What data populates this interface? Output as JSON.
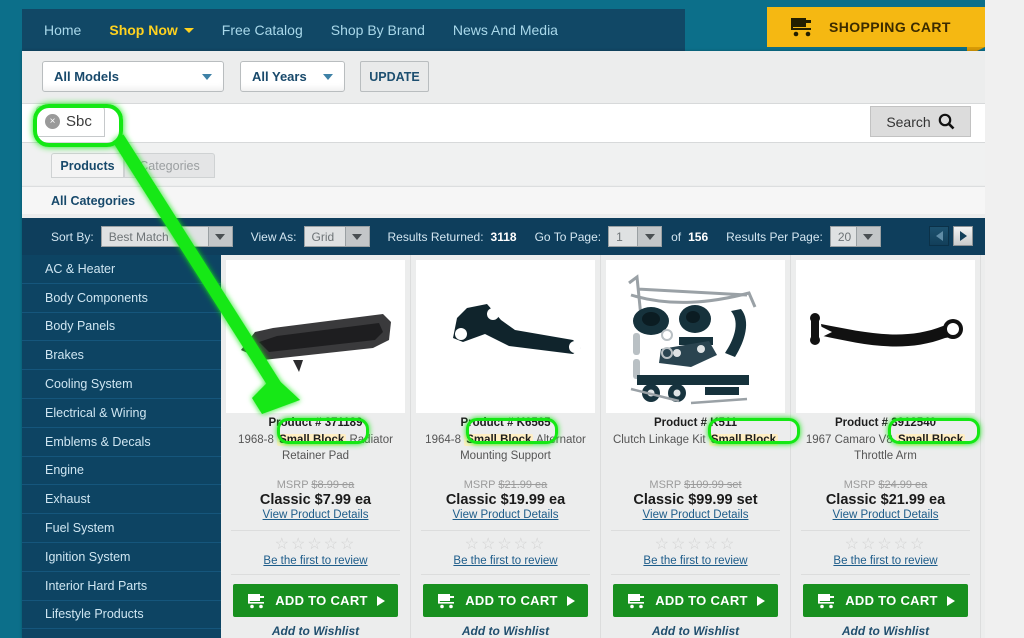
{
  "nav": {
    "items": [
      {
        "label": "Home",
        "active": false
      },
      {
        "label": "Shop Now",
        "active": true
      },
      {
        "label": "Free Catalog",
        "active": false
      },
      {
        "label": "Shop By Brand",
        "active": false
      },
      {
        "label": "News And Media",
        "active": false
      }
    ],
    "cart_label": "SHOPPING CART"
  },
  "filters": {
    "models": "All Models",
    "years": "All Years",
    "update_label": "UPDATE"
  },
  "search": {
    "chip_label": "Sbc",
    "chip_remove": "×",
    "button_label": "Search",
    "input_value": "",
    "placeholder": ""
  },
  "tabs": {
    "products": "Products",
    "categories": "Categories",
    "all_categories": "All Categories"
  },
  "toolbar": {
    "sort_by_label": "Sort By:",
    "sort_by_value": "Best Match",
    "view_as_label": "View As:",
    "view_as_value": "Grid",
    "results_returned_label": "Results Returned:",
    "results_returned_value": "3118",
    "go_to_page_label": "Go To Page:",
    "go_to_page_value": "1",
    "of_label": "of",
    "total_pages": "156",
    "results_per_page_label": "Results Per Page:",
    "results_per_page_value": "20"
  },
  "sidebar": {
    "items": [
      {
        "label": "AC & Heater"
      },
      {
        "label": "Body Components"
      },
      {
        "label": "Body Panels"
      },
      {
        "label": "Brakes"
      },
      {
        "label": "Cooling System"
      },
      {
        "label": "Electrical & Wiring"
      },
      {
        "label": "Emblems & Decals"
      },
      {
        "label": "Engine"
      },
      {
        "label": "Exhaust"
      },
      {
        "label": "Fuel System"
      },
      {
        "label": "Ignition System"
      },
      {
        "label": "Interior Hard Parts"
      },
      {
        "label": "Lifestyle Products"
      }
    ]
  },
  "products": [
    {
      "product_number": "Product # 371189",
      "desc_before": "1968-8",
      "highlight": "Small Block",
      "desc_after": "Radiator Retainer Pad",
      "msrp": "MSRP $8.99 ea",
      "msrp_strike": "$8.99 ea",
      "msrp_prefix": "MSRP ",
      "price": "Classic $7.99 ea",
      "details_link": "View Product Details",
      "review_link": "Be the first to review",
      "add_to_cart": "ADD TO CART",
      "wishlist": "Add to Wishlist",
      "stars": "☆☆☆☆☆",
      "image": "radiator-retainer-pad"
    },
    {
      "product_number": "Product # K6565",
      "desc_before": "1964-8",
      "highlight": "Small Block",
      "desc_after": "Alternator Mounting Support",
      "msrp_prefix": "MSRP ",
      "msrp_strike": "$21.99 ea",
      "price": "Classic $19.99 ea",
      "details_link": "View Product Details",
      "review_link": "Be the first to review",
      "add_to_cart": "ADD TO CART",
      "wishlist": "Add to Wishlist",
      "stars": "☆☆☆☆☆",
      "image": "alternator-mounting-support"
    },
    {
      "product_number": "Product # K511",
      "desc_before": "Clutch Linkage Kit",
      "highlight": "Small Block",
      "desc_after": "",
      "msrp_prefix": "MSRP ",
      "msrp_strike": "$109.99 set",
      "price": "Classic $99.99 set",
      "details_link": "View Product Details",
      "review_link": "Be the first to review",
      "add_to_cart": "ADD TO CART",
      "wishlist": "Add to Wishlist",
      "stars": "☆☆☆☆☆",
      "image": "clutch-linkage-kit"
    },
    {
      "product_number": "Product # 3912540",
      "desc_before": "1967 Camaro V8",
      "highlight": "Small Block",
      "desc_after": "Throttle Arm",
      "msrp_prefix": "MSRP ",
      "msrp_strike": "$24.99 ea",
      "price": "Classic $21.99 ea",
      "details_link": "View Product Details",
      "review_link": "Be the first to review",
      "add_to_cart": "ADD TO CART",
      "wishlist": "Add to Wishlist",
      "stars": "☆☆☆☆☆",
      "image": "throttle-arm"
    }
  ],
  "annotation": {
    "color": "#14e814",
    "description": "green arrow from Sbc chip to first product highlight"
  }
}
